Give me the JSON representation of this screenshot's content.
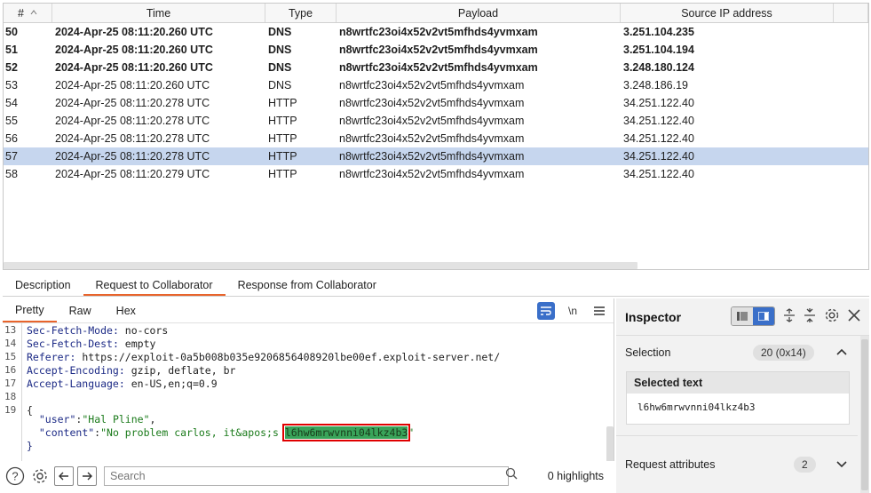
{
  "table": {
    "headers": [
      "#",
      "Time",
      "Type",
      "Payload",
      "Source IP address"
    ],
    "rows": [
      {
        "num": "50",
        "time": "2024-Apr-25 08:11:20.260 UTC",
        "type": "DNS",
        "payload": "n8wrtfc23oi4x52v2vt5mfhds4yvmxam",
        "ip": "3.251.104.235",
        "bold": true,
        "selected": false
      },
      {
        "num": "51",
        "time": "2024-Apr-25 08:11:20.260 UTC",
        "type": "DNS",
        "payload": "n8wrtfc23oi4x52v2vt5mfhds4yvmxam",
        "ip": "3.251.104.194",
        "bold": true,
        "selected": false
      },
      {
        "num": "52",
        "time": "2024-Apr-25 08:11:20.260 UTC",
        "type": "DNS",
        "payload": "n8wrtfc23oi4x52v2vt5mfhds4yvmxam",
        "ip": "3.248.180.124",
        "bold": true,
        "selected": false
      },
      {
        "num": "53",
        "time": "2024-Apr-25 08:11:20.260 UTC",
        "type": "DNS",
        "payload": "n8wrtfc23oi4x52v2vt5mfhds4yvmxam",
        "ip": "3.248.186.19",
        "bold": false,
        "selected": false
      },
      {
        "num": "54",
        "time": "2024-Apr-25 08:11:20.278 UTC",
        "type": "HTTP",
        "payload": "n8wrtfc23oi4x52v2vt5mfhds4yvmxam",
        "ip": "34.251.122.40",
        "bold": false,
        "selected": false
      },
      {
        "num": "55",
        "time": "2024-Apr-25 08:11:20.278 UTC",
        "type": "HTTP",
        "payload": "n8wrtfc23oi4x52v2vt5mfhds4yvmxam",
        "ip": "34.251.122.40",
        "bold": false,
        "selected": false
      },
      {
        "num": "56",
        "time": "2024-Apr-25 08:11:20.278 UTC",
        "type": "HTTP",
        "payload": "n8wrtfc23oi4x52v2vt5mfhds4yvmxam",
        "ip": "34.251.122.40",
        "bold": false,
        "selected": false
      },
      {
        "num": "57",
        "time": "2024-Apr-25 08:11:20.278 UTC",
        "type": "HTTP",
        "payload": "n8wrtfc23oi4x52v2vt5mfhds4yvmxam",
        "ip": "34.251.122.40",
        "bold": false,
        "selected": true
      },
      {
        "num": "58",
        "time": "2024-Apr-25 08:11:20.279 UTC",
        "type": "HTTP",
        "payload": "n8wrtfc23oi4x52v2vt5mfhds4yvmxam",
        "ip": "34.251.122.40",
        "bold": false,
        "selected": false
      }
    ]
  },
  "bottom_tabs": {
    "description": "Description",
    "request": "Request to Collaborator",
    "response": "Response from Collaborator"
  },
  "editor": {
    "tabs": {
      "pretty": "Pretty",
      "raw": "Raw",
      "hex": "Hex"
    },
    "newline_label": "\\n",
    "lines": [
      {
        "n": "13",
        "key": "Sec-Fetch-Mode",
        "value": " no-cors"
      },
      {
        "n": "14",
        "key": "Sec-Fetch-Dest",
        "value": " empty"
      },
      {
        "n": "15",
        "key": "Referer",
        "value": " https://exploit-0a5b008b035e9206856408920lbe00ef.exploit-server.net/"
      },
      {
        "n": "16",
        "key": "Accept-Encoding",
        "value": " gzip, deflate, br"
      },
      {
        "n": "17",
        "key": "Accept-Language",
        "value": " en-US,en;q=0.9"
      },
      {
        "n": "18",
        "key": "",
        "value": ""
      },
      {
        "n": "19",
        "key": "",
        "value": "{"
      }
    ],
    "json_user_key": "\"user\"",
    "json_user_value": "\"Hal Pline\"",
    "json_content_key": "\"content\"",
    "json_content_prefix": "\"No problem carlos, it&apos;s ",
    "json_content_highlight": "l6hw6mrwvnni04lkz4b3",
    "json_content_suffix": "\"",
    "closing_brace": "}"
  },
  "searchbar": {
    "placeholder": "Search",
    "highlights": "0 highlights"
  },
  "inspector": {
    "title": "Inspector",
    "selection_label": "Selection",
    "selection_badge": "20 (0x14)",
    "selected_text_label": "Selected text",
    "selected_text_value": "l6hw6mrwvnni04lkz4b3",
    "request_attributes_label": "Request attributes",
    "request_attributes_count": "2"
  },
  "colors": {
    "accent": "#e8642c",
    "selection_row": "#c6d6ee",
    "active_button": "#3a6fc9",
    "highlight": "#39a45a",
    "highlight_border": "#e00000"
  }
}
